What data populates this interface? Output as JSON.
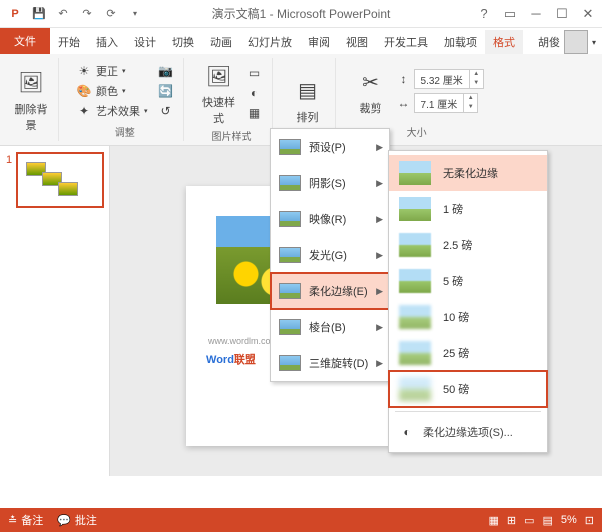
{
  "title": "演示文稿1 - Microsoft PowerPoint",
  "user": "胡俊",
  "tabs": {
    "file": "文件",
    "home": "开始",
    "insert": "插入",
    "design": "设计",
    "trans": "切换",
    "anim": "动画",
    "slideshow": "幻灯片放",
    "review": "审阅",
    "view": "视图",
    "dev": "开发工具",
    "addin": "加载项",
    "format": "格式"
  },
  "ribbon": {
    "removebg": "删除背景",
    "adjust_group": "调整",
    "correct": "更正",
    "color": "颜色",
    "artistic": "艺术效果",
    "styles_group": "图片样式",
    "quickstyle": "快速样式",
    "arrange": "排列",
    "crop": "裁剪",
    "size_group": "大小",
    "height": "5.32 厘米",
    "width": "7.1 厘米"
  },
  "dropdown": {
    "preset": "预设(P)",
    "shadow": "阴影(S)",
    "reflect": "映像(R)",
    "glow": "发光(G)",
    "soft": "柔化边缘(E)",
    "bevel": "棱台(B)",
    "rotate3d": "三维旋转(D)"
  },
  "submenu": {
    "none": "无柔化边缘",
    "p1": "1 磅",
    "p25": "2.5 磅",
    "p5": "5 磅",
    "p10": "10 磅",
    "p25b": "25 磅",
    "p50": "50 磅",
    "options": "柔化边缘选项(S)..."
  },
  "watermark": {
    "url": "www.wordlm.com",
    "w": "W",
    "ord": "ord",
    "alliance": "联盟"
  },
  "status": {
    "notes": "备注",
    "comments": "批注",
    "zoom": "5%"
  },
  "slide_num": "1"
}
